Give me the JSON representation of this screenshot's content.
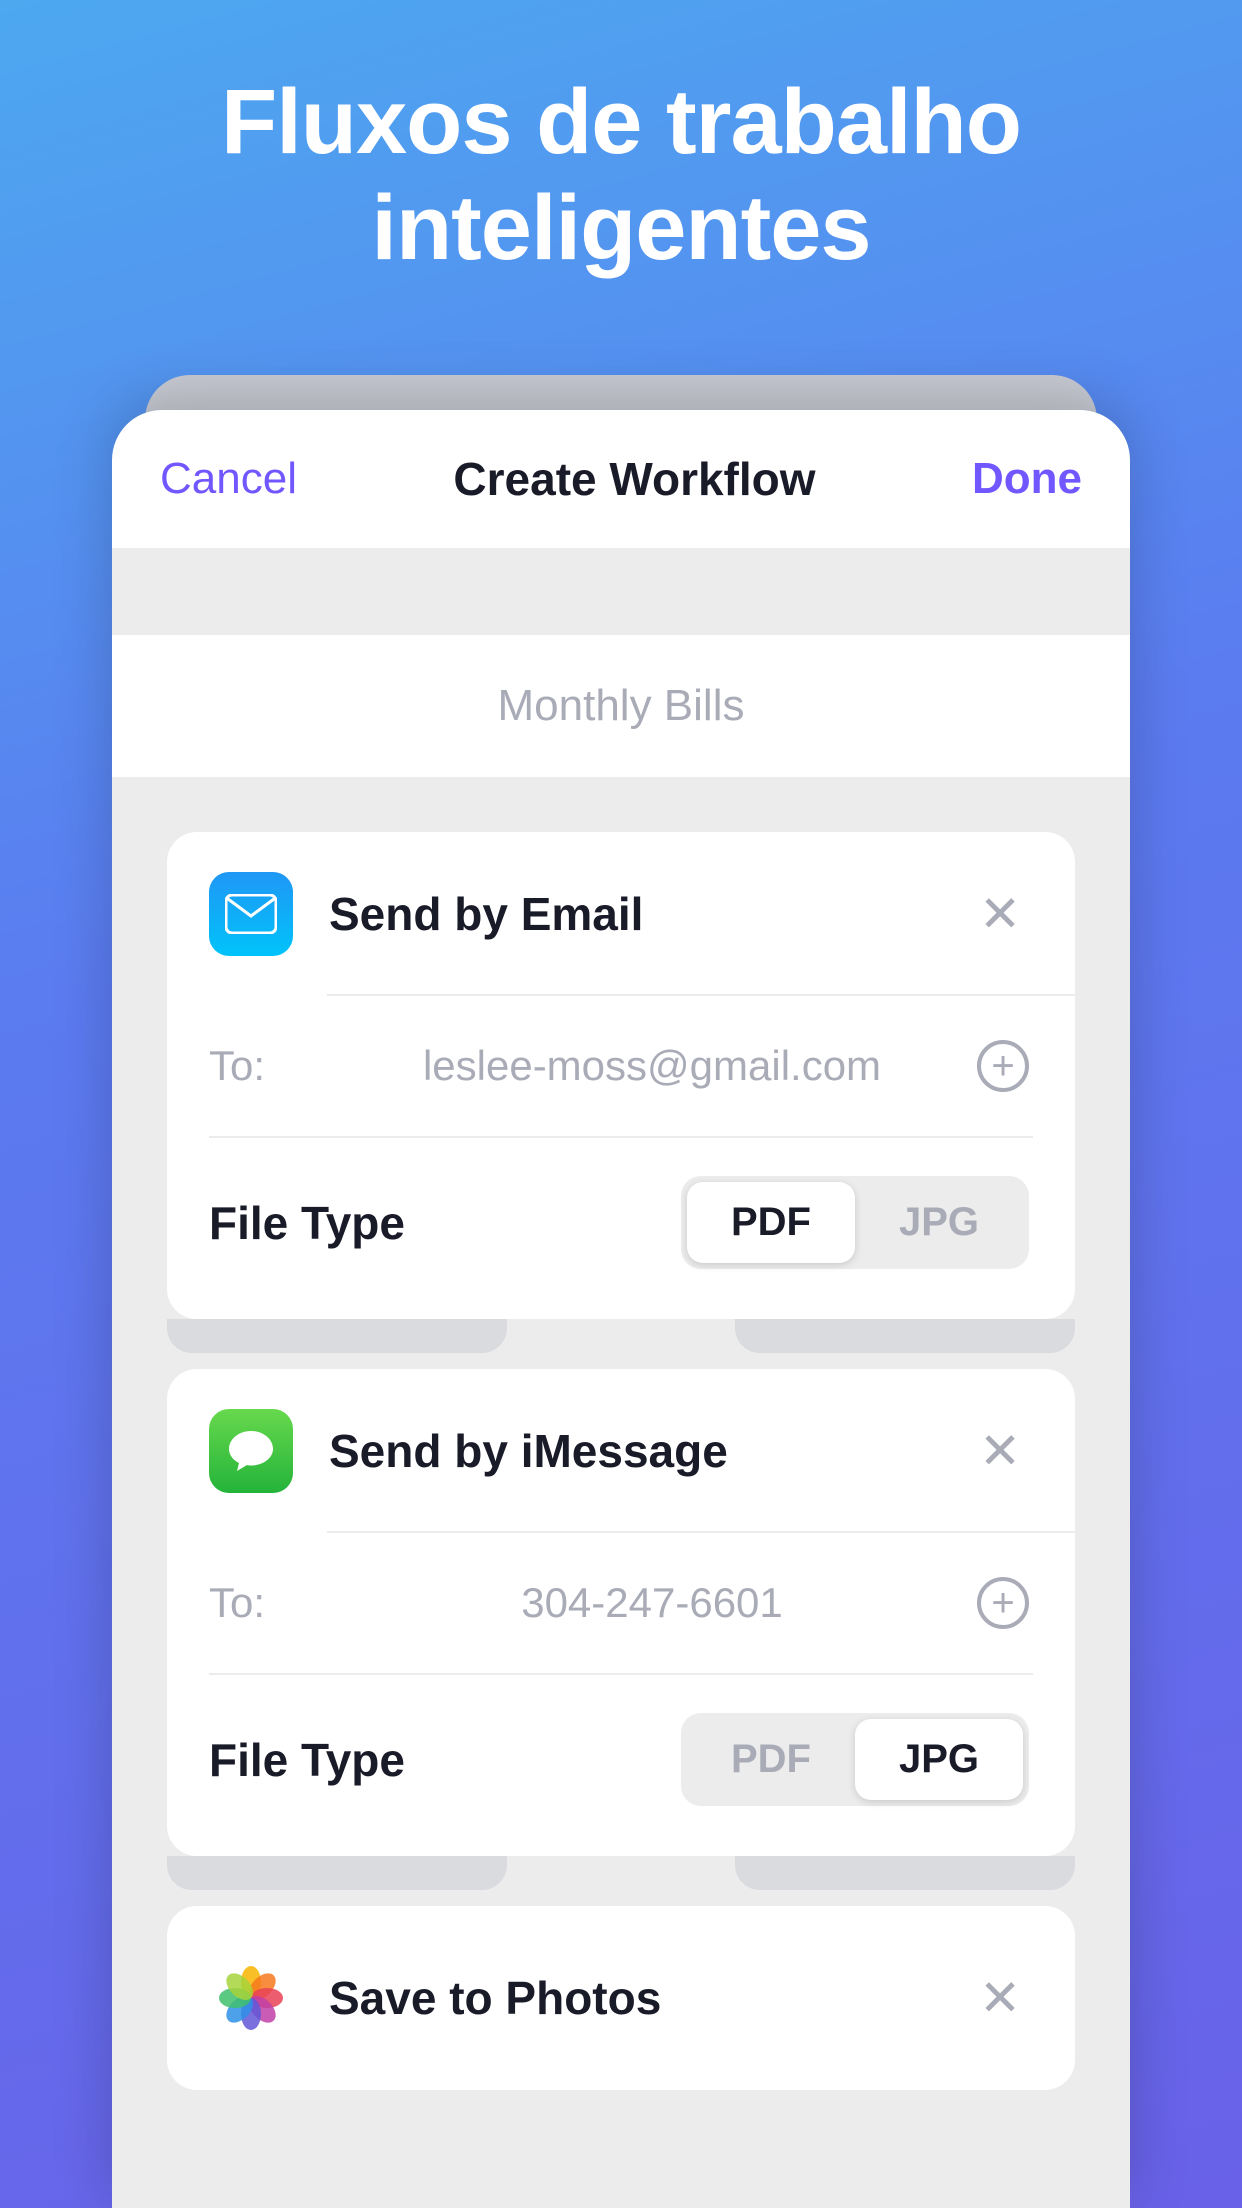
{
  "headline_line1": "Fluxos de trabalho",
  "headline_line2": "inteligentes",
  "sheet": {
    "cancel_label": "Cancel",
    "title": "Create Workflow",
    "done_label": "Done"
  },
  "workflow_name_placeholder": "Monthly Bills",
  "cards": {
    "email": {
      "title": "Send by Email",
      "to_label": "To:",
      "to_value": "leslee-moss@gmail.com",
      "filetype_label": "File Type",
      "option_pdf": "PDF",
      "option_jpg": "JPG",
      "selected": "PDF"
    },
    "imessage": {
      "title": "Send by iMessage",
      "to_label": "To:",
      "to_value": "304-247-6601",
      "filetype_label": "File Type",
      "option_pdf": "PDF",
      "option_jpg": "JPG",
      "selected": "JPG"
    },
    "photos": {
      "title": "Save to Photos"
    }
  }
}
